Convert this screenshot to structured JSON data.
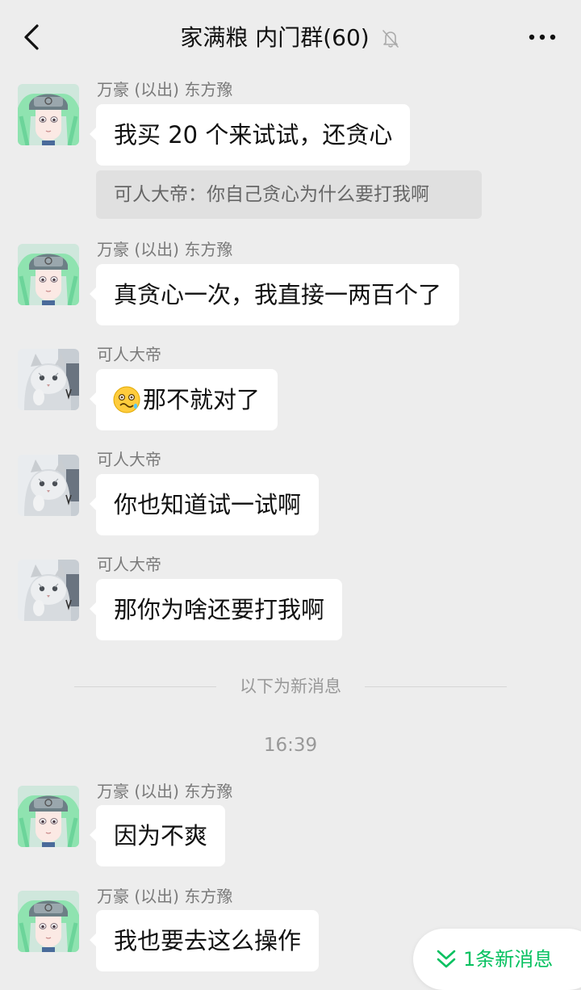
{
  "header": {
    "title": "家满粮 内门群(60)",
    "icons": {
      "back": "chevron-left-icon",
      "mute": "bell-off-icon",
      "more": "more-horizontal-icon"
    }
  },
  "messages": [
    {
      "sender": "万豪 (以出) 东方豫",
      "text": "我买 20 个来试试，还贪心",
      "avatar": "green-hair-anime-avatar",
      "quote": "可人大帝：你自己贪心为什么要打我啊"
    },
    {
      "sender": "万豪 (以出) 东方豫",
      "text": "真贪心一次，我直接一两百个了",
      "avatar": "green-hair-anime-avatar"
    },
    {
      "sender": "可人大帝",
      "text": "那不就对了",
      "avatar": "cat-avatar",
      "emoji": "woozy-face-emoji"
    },
    {
      "sender": "可人大帝",
      "text": "你也知道试一试啊",
      "avatar": "cat-avatar"
    },
    {
      "sender": "可人大帝",
      "text": "那你为啥还要打我啊",
      "avatar": "cat-avatar"
    },
    {
      "sender": "万豪 (以出) 东方豫",
      "text": "因为不爽",
      "avatar": "green-hair-anime-avatar"
    },
    {
      "sender": "万豪 (以出) 东方豫",
      "text": "我也要去这么操作",
      "avatar": "green-hair-anime-avatar"
    }
  ],
  "divider_text": "以下为新消息",
  "timestamp": "16:39",
  "new_messages": {
    "label": "1条新消息",
    "icon": "double-chevron-down-icon"
  },
  "colors": {
    "background": "#ededed",
    "bubble": "#ffffff",
    "accent": "#07c160"
  }
}
